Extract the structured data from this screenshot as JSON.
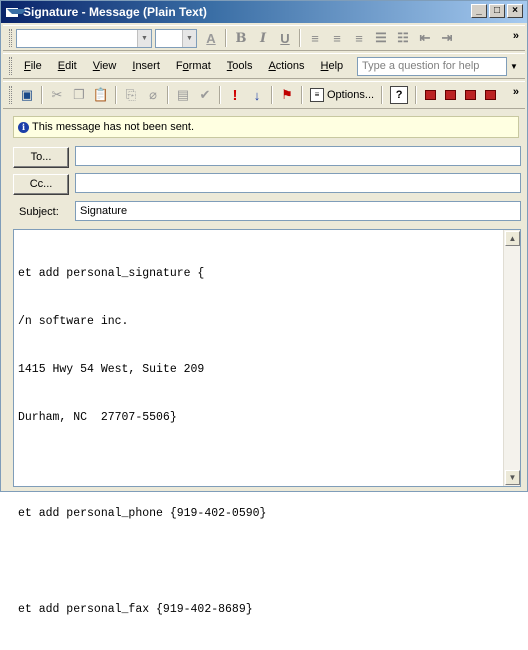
{
  "window": {
    "title": "Signature - Message (Plain Text)",
    "minimize": "_",
    "maximize": "□",
    "close": "×"
  },
  "format_toolbar": {
    "font_box": "",
    "size_box": "",
    "font_color": "A",
    "bold": "B",
    "italic": "I",
    "underline": "U"
  },
  "menu": {
    "items": [
      "File",
      "Edit",
      "View",
      "Insert",
      "Format",
      "Tools",
      "Actions",
      "Help"
    ],
    "accelerators": [
      "F",
      "E",
      "V",
      "I",
      "o",
      "T",
      "A",
      "H"
    ],
    "help_placeholder": "Type a question for help"
  },
  "std_toolbar": {
    "options_label": "Options...",
    "help_label": "?"
  },
  "infobar": {
    "message": "This message has not been sent."
  },
  "addressing": {
    "to_label": "To...",
    "cc_label": "Cc...",
    "to_value": "",
    "cc_value": "",
    "subject_label": "Subject:",
    "subject_value": "Signature"
  },
  "body": {
    "lines": [
      "et add personal_signature {",
      "/n software inc.",
      "1415 Hwy 54 West, Suite 209",
      "Durham, NC  27707-5506}",
      "",
      "et add personal_phone {919-402-0590}",
      "",
      "et add personal_fax {919-402-8689}"
    ]
  },
  "colors": {
    "titlebar_start": "#0a246a",
    "infobar_bg": "#ffffe1",
    "window_bg": "#ece9d8"
  }
}
